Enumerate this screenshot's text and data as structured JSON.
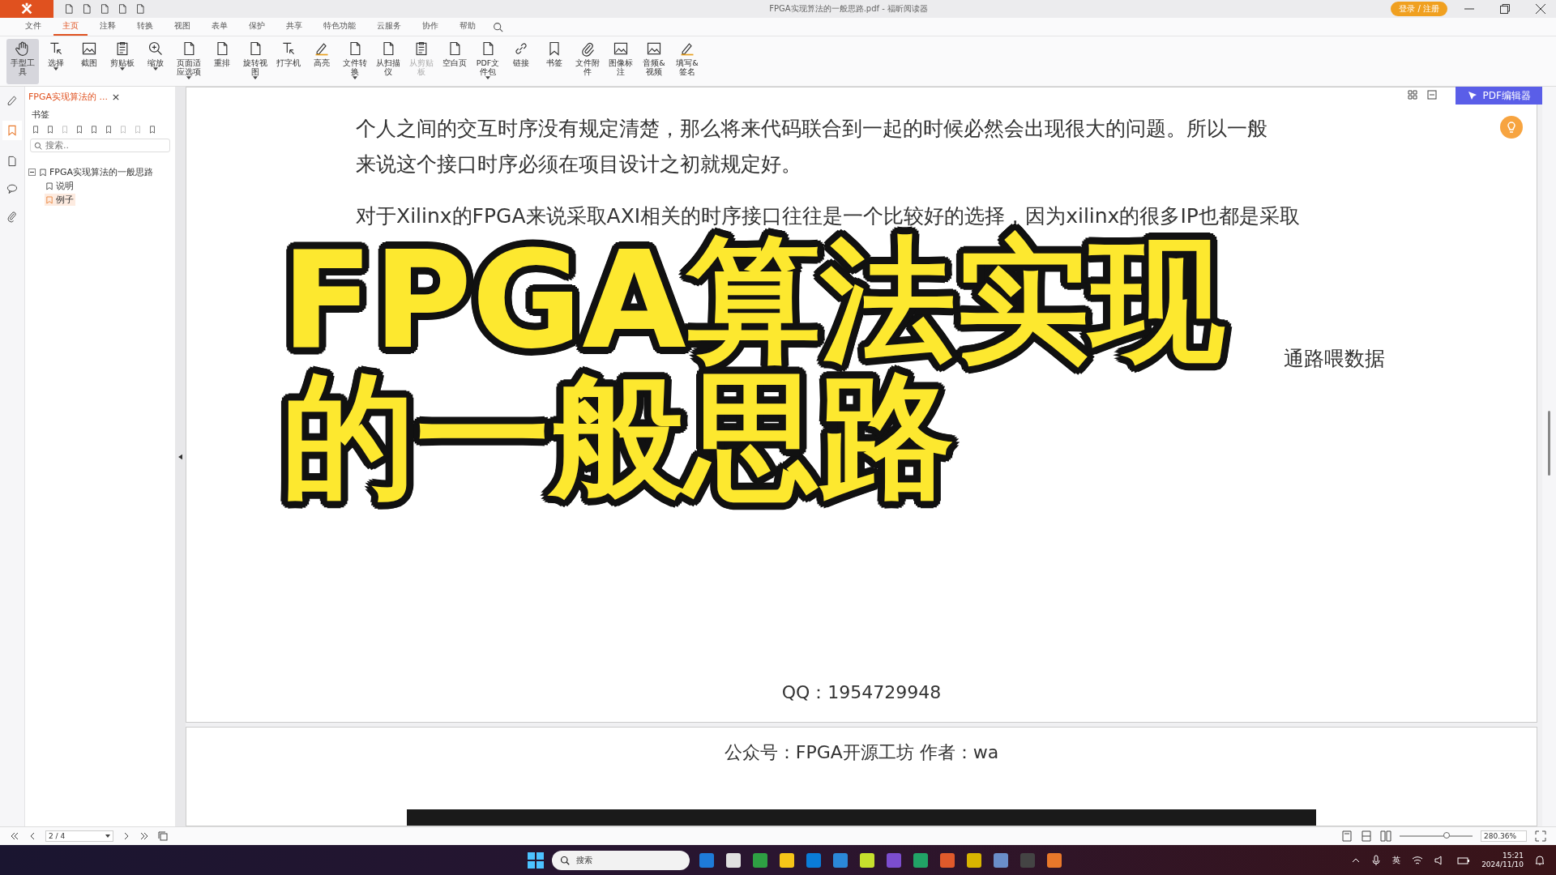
{
  "window": {
    "title": "FPGA实现算法的一般思路.pdf - 福昕阅读器",
    "login_button": "登录 / 注册"
  },
  "ribbon_tabs": [
    {
      "label": "文件",
      "selected": false
    },
    {
      "label": "主页",
      "selected": true
    },
    {
      "label": "注释",
      "selected": false
    },
    {
      "label": "转换",
      "selected": false
    },
    {
      "label": "视图",
      "selected": false
    },
    {
      "label": "表单",
      "selected": false
    },
    {
      "label": "保护",
      "selected": false
    },
    {
      "label": "共享",
      "selected": false
    },
    {
      "label": "特色功能",
      "selected": false
    },
    {
      "label": "云服务",
      "selected": false
    },
    {
      "label": "协作",
      "selected": false
    },
    {
      "label": "帮助",
      "selected": false
    }
  ],
  "tools": [
    {
      "label": "手型工具",
      "dropdown": false,
      "disabled": false,
      "selected": true
    },
    {
      "label": "选择",
      "dropdown": true,
      "disabled": false,
      "selected": false
    },
    {
      "label": "截图",
      "dropdown": false,
      "disabled": false,
      "selected": false
    },
    {
      "label": "剪贴板",
      "dropdown": true,
      "disabled": false,
      "selected": false
    },
    {
      "label": "缩放",
      "dropdown": true,
      "disabled": false,
      "selected": false
    },
    {
      "label": "页面适应选项",
      "dropdown": true,
      "disabled": false,
      "selected": false
    },
    {
      "label": "重排",
      "dropdown": false,
      "disabled": false,
      "selected": false
    },
    {
      "label": "旋转视图",
      "dropdown": true,
      "disabled": false,
      "selected": false
    },
    {
      "label": "打字机",
      "dropdown": false,
      "disabled": false,
      "selected": false
    },
    {
      "label": "高亮",
      "dropdown": false,
      "disabled": false,
      "selected": false
    },
    {
      "label": "文件转换",
      "dropdown": true,
      "disabled": false,
      "selected": false
    },
    {
      "label": "从扫描仪",
      "dropdown": false,
      "disabled": false,
      "selected": false
    },
    {
      "label": "从剪贴板",
      "dropdown": false,
      "disabled": true,
      "selected": false
    },
    {
      "label": "空白页",
      "dropdown": false,
      "disabled": false,
      "selected": false
    },
    {
      "label": "PDF文件包",
      "dropdown": true,
      "disabled": false,
      "selected": false
    },
    {
      "label": "链接",
      "dropdown": false,
      "disabled": false,
      "selected": false
    },
    {
      "label": "书签",
      "dropdown": false,
      "disabled": false,
      "selected": false
    },
    {
      "label": "文件附件",
      "dropdown": false,
      "disabled": false,
      "selected": false
    },
    {
      "label": "图像标注",
      "dropdown": false,
      "disabled": false,
      "selected": false
    },
    {
      "label": "音频&视频",
      "dropdown": false,
      "disabled": false,
      "selected": false
    },
    {
      "label": "填写&签名",
      "dropdown": false,
      "disabled": false,
      "selected": false
    }
  ],
  "sidebar": {
    "doc_tab": "FPGA实现算法的 ...",
    "panel_title": "书签",
    "search": {
      "placeholder": "搜索.."
    },
    "bookmarks": [
      {
        "label": "FPGA实现算法的一般思路",
        "expanded": true,
        "selected": false,
        "children": [
          {
            "label": "说明",
            "selected": false
          },
          {
            "label": "例子",
            "selected": true
          }
        ]
      }
    ]
  },
  "editor_button": "PDF编辑器",
  "page": {
    "lines": [
      [
        "个人之间的交互时序没有规定清楚，那么将来代码联合到一起的时候必然会出现很大的问题。所以一般"
      ],
      [
        "来说这个接口时序必须在项目设计之初就规定好。"
      ],
      [
        "对于Xilinx的FPGA来说采取AXI相关的时序接口往往是一个比较好的选择，因为xilinx的很多IP也都是采取"
      ],
      [
        "通路喂数据"
      ]
    ],
    "footer": "QQ：1954729948"
  },
  "page_2": {
    "header": "公众号：FPGA开源工坊 作者：wa"
  },
  "overlay_title": [
    "FPGA算法实现",
    "的一般思路"
  ],
  "status_bar": {
    "page_field": "2 / 4",
    "zoom": "280.36%",
    "zoom_slider": {
      "level": 0.65
    }
  },
  "taskbar": {
    "search": "搜索",
    "input_method": "英",
    "time": "15:21",
    "date": "2024/11/10"
  }
}
